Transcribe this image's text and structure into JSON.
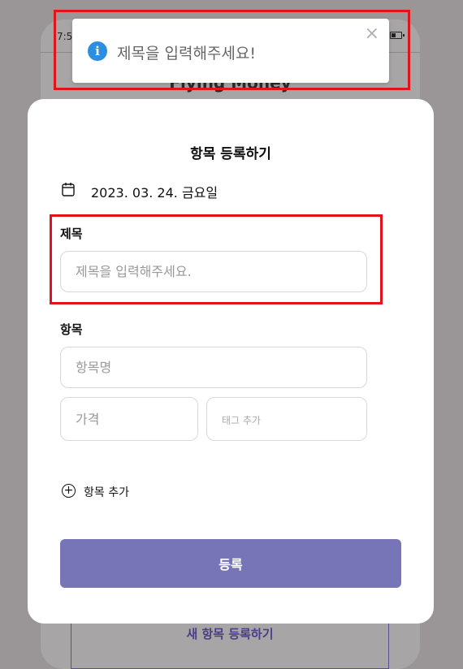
{
  "status_bar": {
    "time": "7:5"
  },
  "background_app": {
    "title": "Flying Money",
    "new_item_button_label": "새 항목 등록하기"
  },
  "toast": {
    "icon": "info-icon",
    "message": "제목을 입력해주세요!",
    "close_symbol": "×",
    "accent_color": "#2e8ede"
  },
  "modal": {
    "title": "항목 등록하기",
    "date": "2023. 03. 24. 금요일",
    "title_section": {
      "label": "제목",
      "placeholder": "제목을 입력해주세요."
    },
    "item_section": {
      "label": "항목",
      "name_placeholder": "항목명",
      "price_placeholder": "가격",
      "tag_placeholder": "태그 추가"
    },
    "add_item_label": "항목 추가",
    "submit_label": "등록",
    "submit_color": "#7775b8"
  },
  "annotations": {
    "highlight_color": "#e0141a"
  }
}
